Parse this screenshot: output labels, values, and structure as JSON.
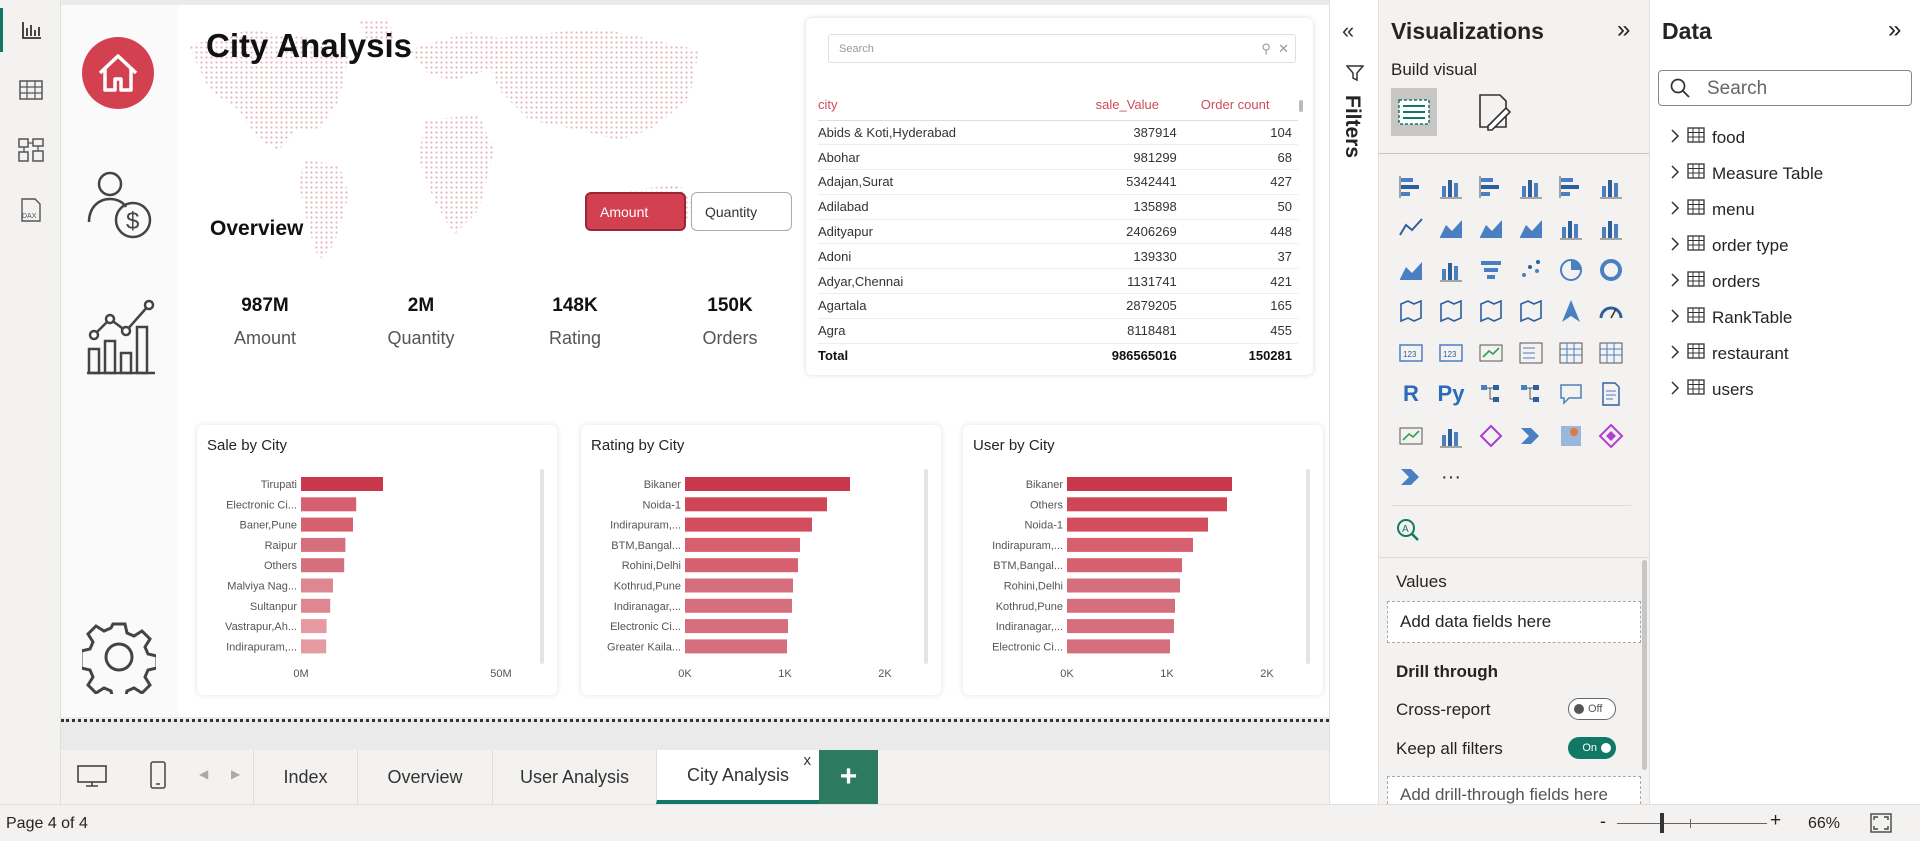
{
  "report": {
    "title": "City Analysis",
    "overview_label": "Overview",
    "toggle": {
      "amount": "Amount",
      "quantity": "Quantity"
    },
    "kpis": [
      {
        "value": "987M",
        "label": "Amount"
      },
      {
        "value": "2M",
        "label": "Quantity"
      },
      {
        "value": "148K",
        "label": "Rating"
      },
      {
        "value": "150K",
        "label": "Orders"
      }
    ],
    "table": {
      "search_placeholder": "Search",
      "columns": [
        "city",
        "sale_Value",
        "Order count"
      ],
      "rows": [
        [
          "Abids & Koti,Hyderabad",
          "387914",
          "104"
        ],
        [
          "Abohar",
          "981299",
          "68"
        ],
        [
          "Adajan,Surat",
          "5342441",
          "427"
        ],
        [
          "Adilabad",
          "135898",
          "50"
        ],
        [
          "Adityapur",
          "2406269",
          "448"
        ],
        [
          "Adoni",
          "139330",
          "37"
        ],
        [
          "Adyar,Chennai",
          "1131741",
          "421"
        ],
        [
          "Agartala",
          "2879205",
          "165"
        ],
        [
          "Agra",
          "8118481",
          "455"
        ]
      ],
      "total": [
        "Total",
        "986565016",
        "150281"
      ]
    }
  },
  "chart_data": [
    {
      "type": "bar",
      "title": "Sale by City",
      "orientation": "horizontal",
      "categories": [
        "Tirupati",
        "Electronic Ci...",
        "Baner,Pune",
        "Raipur",
        "Others",
        "Malviya Nag...",
        "Sultanpur",
        "Vastrapur,Ah...",
        "Indirapuram,..."
      ],
      "values": [
        20.5,
        13.8,
        13.0,
        11.1,
        10.8,
        8.0,
        7.3,
        6.4,
        6.3
      ],
      "xlim": [
        0,
        50
      ],
      "tick_labels": [
        "0M",
        "50M"
      ],
      "colors": [
        "#c8384a",
        "#d6606f",
        "#d6606f",
        "#d66f7d",
        "#d66f7d",
        "#df8790",
        "#df8790",
        "#e69aa2",
        "#e69aa2"
      ]
    },
    {
      "type": "bar",
      "title": "Rating by City",
      "orientation": "horizontal",
      "categories": [
        "Bikaner",
        "Noida-1",
        "Indirapuram,...",
        "BTM,Bangal...",
        "Rohini,Delhi",
        "Kothrud,Pune",
        "Indiranagar,...",
        "Electronic Ci...",
        "Greater Kaila..."
      ],
      "values": [
        1650,
        1420,
        1270,
        1150,
        1130,
        1080,
        1070,
        1030,
        1020
      ],
      "xlim": [
        0,
        2000
      ],
      "tick_labels": [
        "0K",
        "1K",
        "2K"
      ],
      "colors": [
        "#c8384a",
        "#cf4757",
        "#d24e5e",
        "#d6606f",
        "#d6606f",
        "#d66f7d",
        "#d66f7d",
        "#d66f7d",
        "#d66f7d"
      ]
    },
    {
      "type": "bar",
      "title": "User by City",
      "orientation": "horizontal",
      "categories": [
        "Bikaner",
        "Others",
        "Noida-1",
        "Indirapuram,...",
        "BTM,Bangal...",
        "Rohini,Delhi",
        "Kothrud,Pune",
        "Indiranagar,...",
        "Electronic Ci..."
      ],
      "values": [
        1650,
        1600,
        1410,
        1260,
        1150,
        1130,
        1080,
        1070,
        1030
      ],
      "xlim": [
        0,
        2000
      ],
      "tick_labels": [
        "0K",
        "1K",
        "2K"
      ],
      "colors": [
        "#c8384a",
        "#cf4757",
        "#d24e5e",
        "#d6606f",
        "#d6606f",
        "#d66f7d",
        "#d66f7d",
        "#d66f7d",
        "#d66f7d"
      ]
    }
  ],
  "pages": {
    "tabs": [
      "Index",
      "Overview",
      "User Analysis",
      "City Analysis"
    ],
    "active": "City Analysis",
    "close_glyph": "x",
    "add_glyph": "+"
  },
  "filters": {
    "label": "Filters"
  },
  "visualizations": {
    "title": "Visualizations",
    "build_visual": "Build visual",
    "icons": [
      "stacked-bar-icon",
      "stacked-column-icon",
      "clustered-bar-icon",
      "clustered-column-icon",
      "100-bar-icon",
      "100-column-icon",
      "line-chart-icon",
      "area-chart-icon",
      "stacked-area-icon",
      "100-area-icon",
      "line-column-icon",
      "line-clustered-column-icon",
      "ribbon-chart-icon",
      "waterfall-icon",
      "funnel-icon",
      "scatter-icon",
      "pie-icon",
      "donut-icon",
      "treemap-icon",
      "map-icon",
      "filled-map-icon",
      "shape-map-icon",
      "azure-map-icon",
      "gauge-icon",
      "card-icon",
      "multirow-card-icon",
      "kpi-icon",
      "slicer-icon",
      "table-icon",
      "matrix-icon",
      "r-visual-icon",
      "python-visual-icon",
      "key-influencers-icon",
      "decomposition-tree-icon",
      "qa-icon",
      "smart-narrative-icon",
      "metrics-icon",
      "paginated-report-icon",
      "power-apps-icon",
      "power-automate-icon",
      "arcgis-icon",
      "diamond-visual-icon",
      "chevron-visual-icon",
      "more-visuals-icon"
    ],
    "more_glyph": "···",
    "r_text": "R",
    "py_text": "Py",
    "values_label": "Values",
    "values_placeholder": "Add data fields here",
    "drill_through": "Drill through",
    "cross_report": "Cross-report",
    "cross_report_state": "Off",
    "keep_filters": "Keep all filters",
    "keep_filters_state": "On",
    "drill_placeholder": "Add drill-through fields here"
  },
  "data_pane": {
    "title": "Data",
    "search_placeholder": "Search",
    "tables": [
      "food",
      "Measure Table",
      "menu",
      "order type",
      "orders",
      "RankTable",
      "restaurant",
      "users"
    ]
  },
  "status": {
    "page": "Page 4 of 4",
    "zoom": "66%",
    "minus": "-",
    "plus": "+"
  },
  "colors": {
    "accent": "#117865",
    "brand_red": "#d3404f"
  }
}
